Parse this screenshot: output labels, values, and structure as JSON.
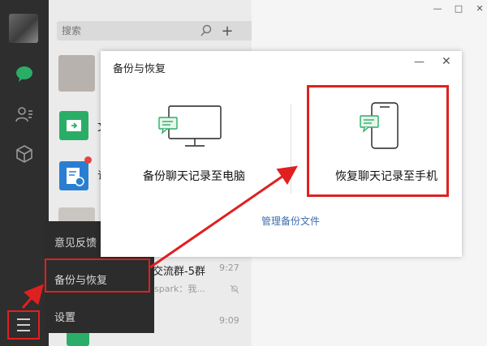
{
  "search": {
    "placeholder": "搜索"
  },
  "chat_list": [
    {
      "name": "文",
      "time": "",
      "preview": ""
    },
    {
      "name": "订",
      "time": "",
      "preview": ""
    },
    {
      "name": "交流群-5群",
      "time": "9:27",
      "preview": "spark：我..."
    },
    {
      "name": "",
      "time": "9:09",
      "preview": ""
    }
  ],
  "window_controls": {
    "minimize": "—",
    "maximize": "□",
    "close": "✕"
  },
  "popup_menu": {
    "feedback": "意见反馈",
    "backup": "备份与恢复",
    "settings": "设置"
  },
  "dialog": {
    "title": "备份与恢复",
    "minimize": "—",
    "close": "✕",
    "backup_to_pc": "备份聊天记录至电脑",
    "restore_to_phone": "恢复聊天记录至手机",
    "manage_link": "管理备份文件"
  },
  "colors": {
    "accent_green": "#2aae67",
    "highlight_red": "#e02020",
    "link_blue": "#3d6fb0"
  }
}
